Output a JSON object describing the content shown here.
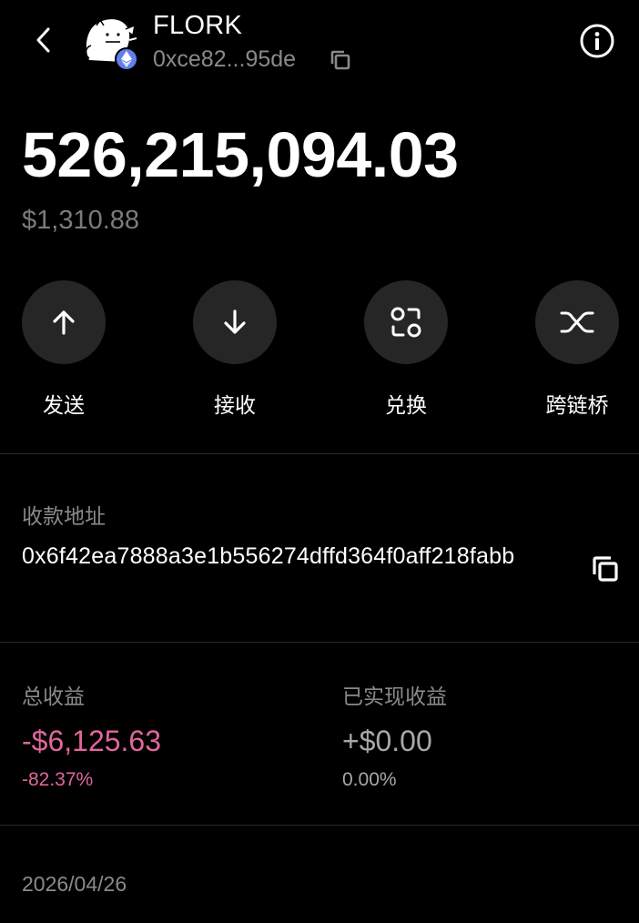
{
  "header": {
    "token_name": "FLORK",
    "contract_short": "0xce82...95de",
    "avatar_icon": "flork-cartoon-icon",
    "chain_badge_icon": "ethereum-icon",
    "chain_badge_color": "#627eea"
  },
  "balance": {
    "amount": "526,215,094.03",
    "fiat": "$1,310.88"
  },
  "actions": [
    {
      "label": "发送",
      "icon": "arrow-up-icon"
    },
    {
      "label": "接收",
      "icon": "arrow-down-icon"
    },
    {
      "label": "兑换",
      "icon": "swap-icon"
    },
    {
      "label": "跨链桥",
      "icon": "bridge-icon"
    }
  ],
  "receive_address": {
    "label": "收款地址",
    "address": "0x6f42ea7888a3e1b556274dffd364f0aff218fabb"
  },
  "pnl": {
    "total_label": "总收益",
    "total_value": "-$6,125.63",
    "total_pct": "-82.37%",
    "realized_label": "已实现收益",
    "realized_value": "+$0.00",
    "realized_pct": "0.00%",
    "negative_color": "#e0669a",
    "neutral_color": "#a8a8a8"
  },
  "footer": {
    "date": "2026/04/26"
  }
}
